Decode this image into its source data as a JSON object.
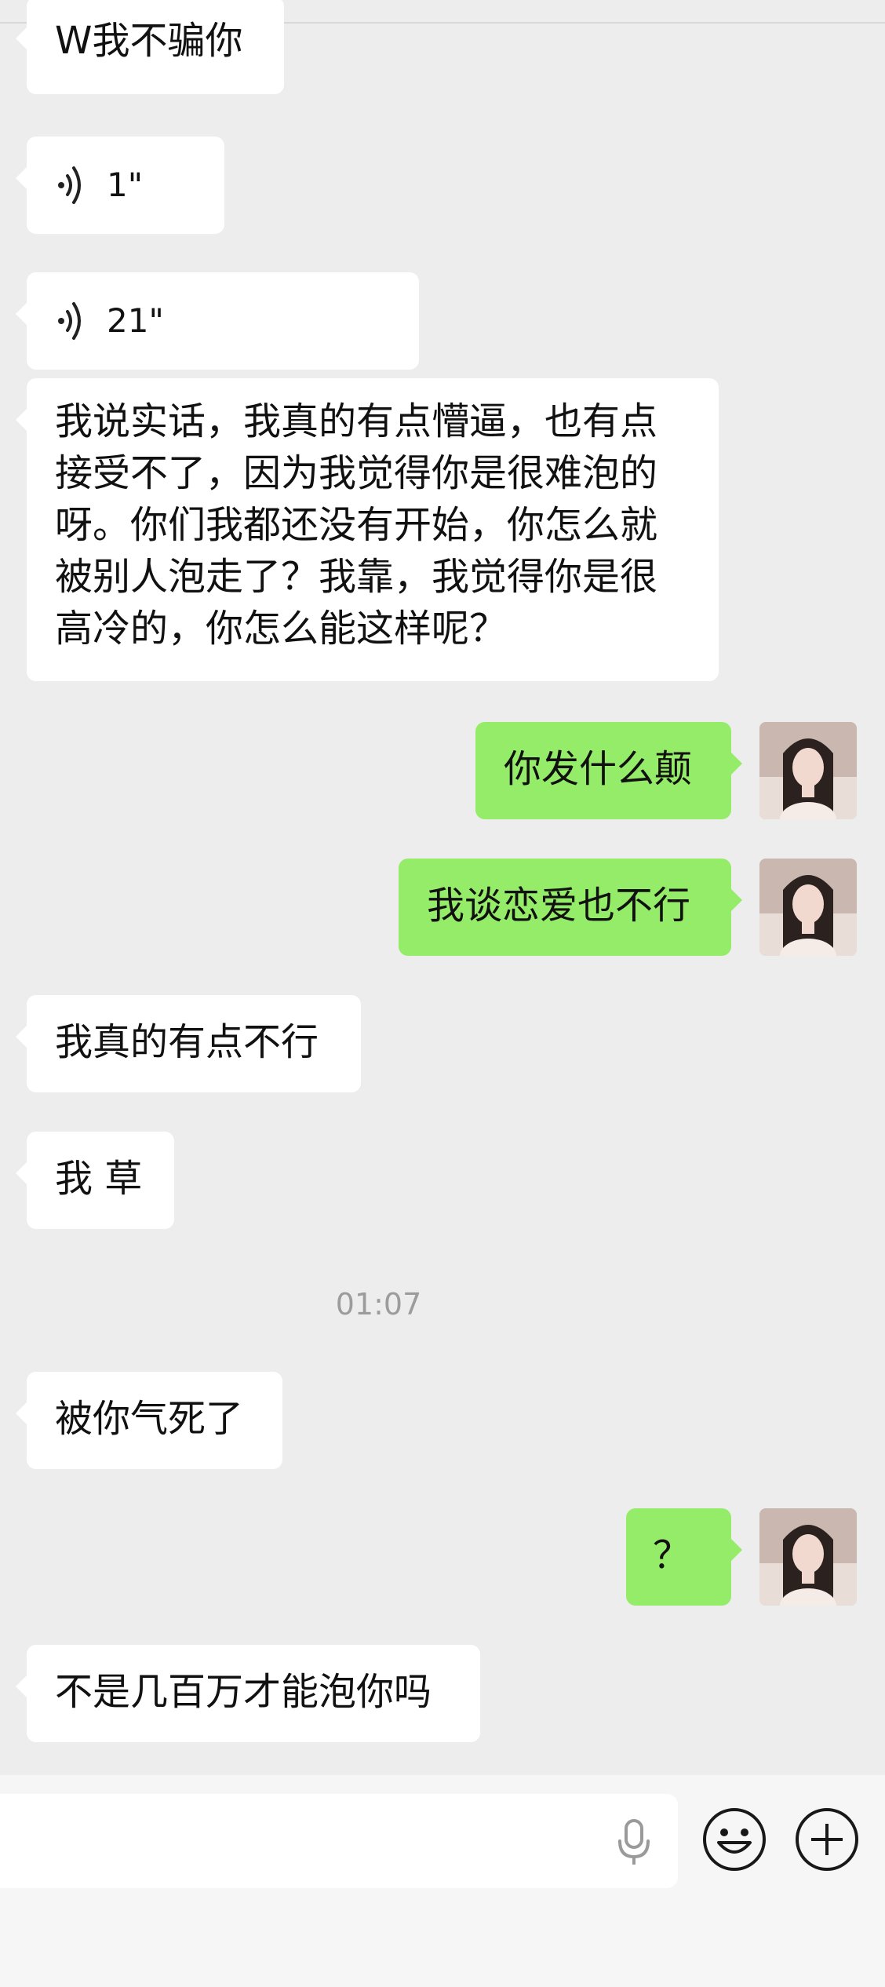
{
  "messages": {
    "m1": "W我不骗你",
    "m2_duration": "1\"",
    "m3_duration": "21\"",
    "m4": "我说实话，我真的有点懵逼，也有点接受不了，因为我觉得你是很难泡的呀。你们我都还没有开始，你怎么就被别人泡走了？我靠，我觉得你是很高冷的，你怎么能这样呢？",
    "m5": "你发什么颠",
    "m6": "我谈恋爱也不行",
    "m7": "我真的有点不行",
    "m8": "我 草",
    "m9": "被你气死了",
    "m10": "？",
    "m11": "不是几百万才能泡你吗"
  },
  "timestamp": "01:07",
  "icons": {
    "voice": "voice-wave-icon",
    "mic": "microphone-icon",
    "emoji": "smiley-icon",
    "plus": "plus-circle-icon"
  },
  "colors": {
    "background": "#ededed",
    "incoming_bubble": "#ffffff",
    "outgoing_bubble": "#95ec69",
    "timestamp_text": "#9c9c9c"
  }
}
